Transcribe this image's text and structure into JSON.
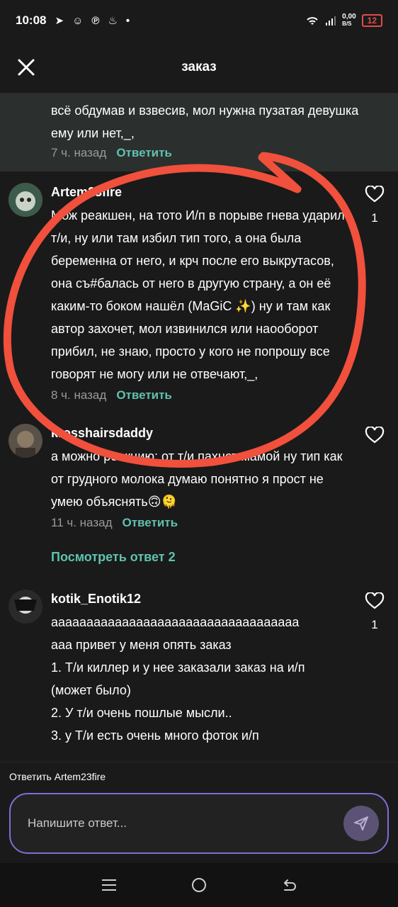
{
  "status": {
    "time": "10:08",
    "network_speed_value": "0,00",
    "network_speed_unit": "B/S",
    "battery": "12"
  },
  "header": {
    "title": "заказ"
  },
  "highlighted_reply": {
    "text": "всё обдумав и взвесив, мол нужна пузатая девушка ему или нет,_,",
    "time": "7 ч. назад",
    "reply_label": "Ответить"
  },
  "comments": [
    {
      "username": "Artem23fire",
      "text": "Мож реакшен, на тото И/п в порыве гнева ударил т/и, ну или там избил тип того, а она была беременна от него, и крч после его выкрутасов, она съ#балась от него в другую страну, а он её каким-то боком нашёл (MaGiC ✨) ну и там как автор захочет, мол извинился или наооборот прибил, не знаю, просто у кого не попрошу все говорят не могу или не отвечают,_,",
      "time": "8 ч. назад",
      "reply_label": "Ответить",
      "likes": "1"
    },
    {
      "username": "krosshairsdaddy",
      "text": "а можно реакцию: от т/и пахнет мамой ну тип как от грудного молока думаю понятно я прост не умею объяснять🙃🫠",
      "time": "11 ч. назад",
      "reply_label": "Ответить",
      "likes": ""
    },
    {
      "username": "kotik_Enotik12",
      "text_lines": [
        "ааааааааааааааааааааааааааааааааааа",
        "ааа привет у меня опять заказ",
        "1. Т/и киллер и у нее заказали заказ на и/п",
        "(может было)",
        "2. У т/и очень пошлые мысли..",
        "3. у Т/и есть очень много фоток и/п"
      ],
      "likes": "1"
    }
  ],
  "view_replies_label": "Посмотреть ответ 2",
  "reply_bar": {
    "reply_to": "Ответить Artem23fire",
    "placeholder": "Напишите ответ..."
  },
  "colors": {
    "accent": "#5fc2b0",
    "input_border": "#7d6fd6",
    "annotation_circle": "#f0503c"
  }
}
